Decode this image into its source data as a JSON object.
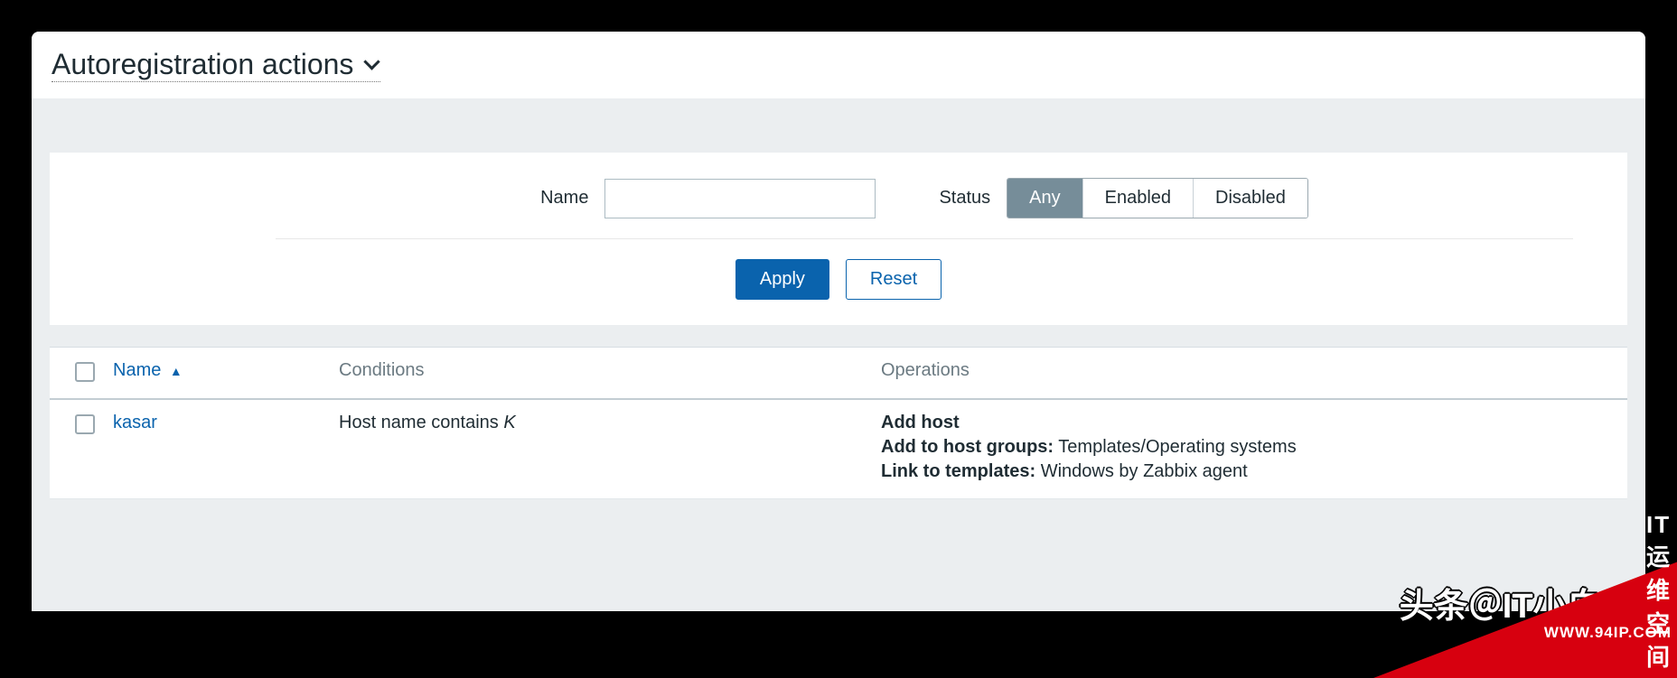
{
  "page": {
    "title": "Autoregistration actions"
  },
  "filter": {
    "name_label": "Name",
    "name_value": "",
    "status_label": "Status",
    "status_options": {
      "any": "Any",
      "enabled": "Enabled",
      "disabled": "Disabled"
    },
    "apply_label": "Apply",
    "reset_label": "Reset"
  },
  "table": {
    "columns": {
      "name": "Name",
      "conditions": "Conditions",
      "operations": "Operations"
    },
    "rows": [
      {
        "name": "kasar",
        "condition_prefix": "Host name contains ",
        "condition_value": "K",
        "operations": [
          {
            "label": "Add host",
            "value": ""
          },
          {
            "label": "Add to host groups:",
            "value": "Templates/Operating systems"
          },
          {
            "label": "Link to templates:",
            "value": "Windows by Zabbix agent"
          }
        ]
      }
    ]
  },
  "watermark": {
    "outline": "头条＠IT小白K",
    "url": "WWW.94IP.COM",
    "brand": "IT运维空间"
  }
}
